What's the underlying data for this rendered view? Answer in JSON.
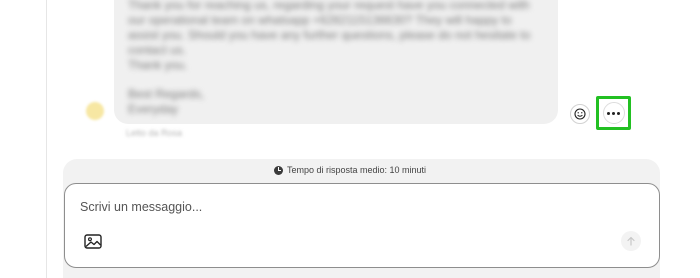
{
  "message": {
    "lines": [
      "Thank you for reaching us, regarding your request have you connected with",
      "our operational team on whatsapp +6282115136630? They will happy to",
      "assist you. Should you have any further questions, please do not hesitate to",
      "contact us.",
      "Thank you.",
      "",
      "Best Regards,",
      "Everyday"
    ],
    "meta": "Letto da Rosa"
  },
  "actions": {
    "emoji_icon": "smiley-icon",
    "more_icon": "ellipsis-icon",
    "highlight_color": "#22c022"
  },
  "composer": {
    "response_time_text": "Tempo di risposta medio: 10 minuti",
    "placeholder": "Scrivi un messaggio...",
    "image_icon": "image-icon",
    "send_icon": "arrow-up-icon"
  }
}
